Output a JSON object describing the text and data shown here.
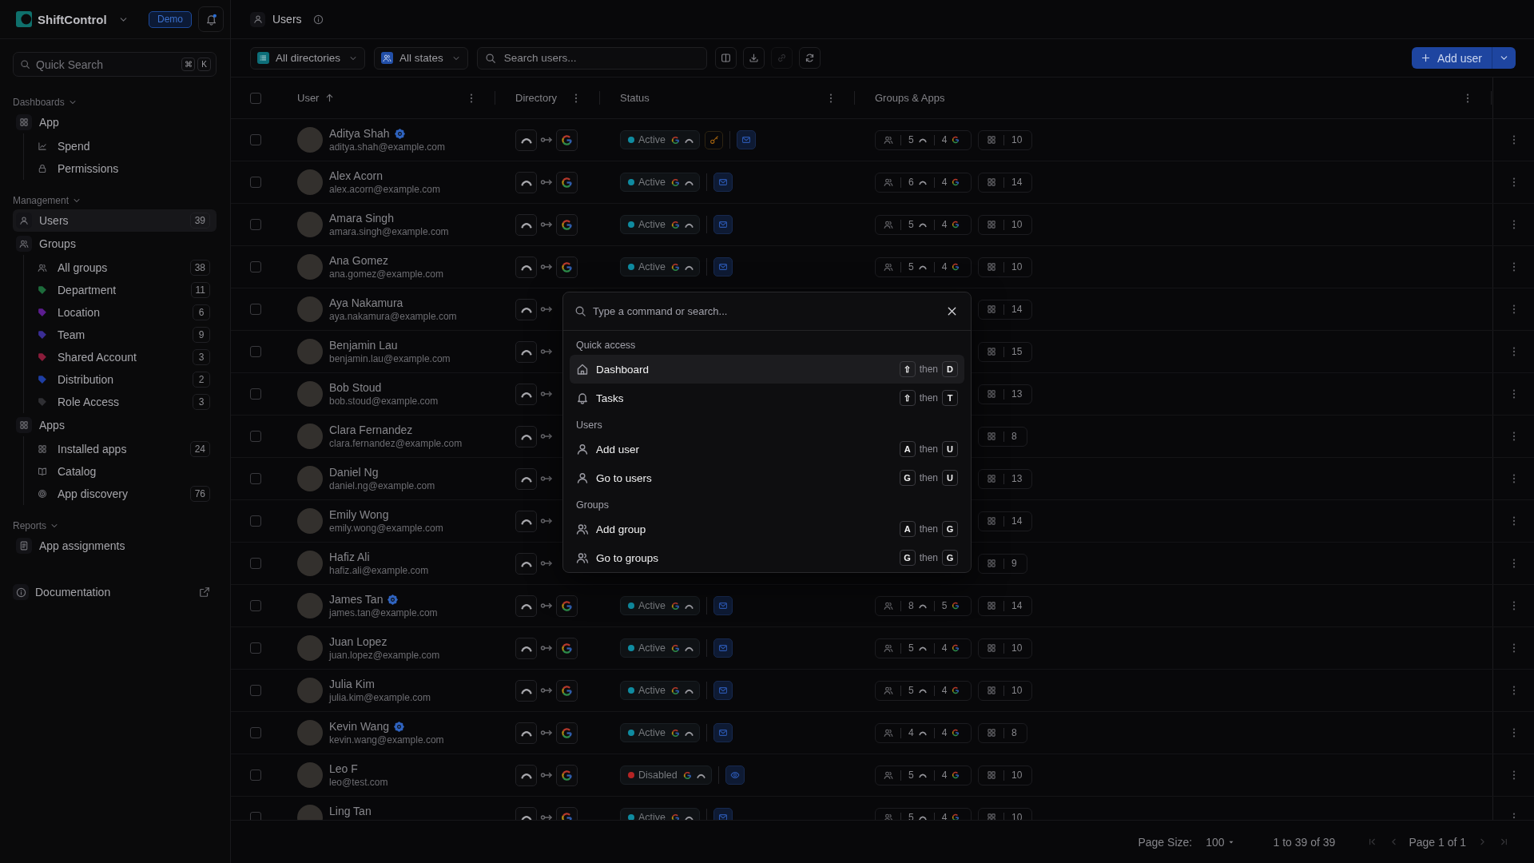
{
  "sidebar": {
    "brand": "ShiftControl",
    "badge": "Demo",
    "notifications": true,
    "search": {
      "placeholder": "Quick Search",
      "keys": [
        "⌘",
        "K"
      ]
    },
    "sections": [
      {
        "label": "Dashboards",
        "expanded": true,
        "items": [
          {
            "label": "App",
            "selected": false,
            "children": [
              {
                "label": "Spend",
                "kind": "page",
                "selected": false
              },
              {
                "label": "Permissions",
                "kind": "page",
                "selected": false
              }
            ]
          }
        ]
      },
      {
        "label": "Management",
        "expanded": true,
        "items": [
          {
            "label": "Users",
            "count": "39",
            "selected": true
          },
          {
            "label": "Groups",
            "selected": false,
            "children": [
              {
                "label": "All groups",
                "kind": "page",
                "count": "38",
                "selected": false
              },
              {
                "label": "Department",
                "kind": "tag",
                "color": "#1d6b3b",
                "count": "11",
                "selected": false
              },
              {
                "label": "Location",
                "kind": "tag",
                "color": "#5c1d8f",
                "count": "6",
                "selected": false
              },
              {
                "label": "Team",
                "kind": "tag",
                "color": "#3a2d94",
                "count": "9",
                "selected": false
              },
              {
                "label": "Shared Account",
                "kind": "tag",
                "color": "#8a1c3a",
                "count": "3",
                "selected": false
              },
              {
                "label": "Distribution",
                "kind": "tag",
                "color": "#1e3ea3",
                "count": "2",
                "selected": false
              },
              {
                "label": "Role Access",
                "kind": "tag",
                "color": "#2f2f33",
                "count": "3",
                "selected": false
              }
            ]
          },
          {
            "label": "Apps",
            "selected": false,
            "children": [
              {
                "label": "Installed apps",
                "kind": "page",
                "count": "24",
                "selected": false
              },
              {
                "label": "Catalog",
                "kind": "page",
                "selected": false
              },
              {
                "label": "App discovery",
                "kind": "page",
                "count": "76",
                "selected": false
              }
            ]
          }
        ]
      },
      {
        "label": "Reports",
        "expanded": true,
        "items": [
          {
            "label": "App assignments",
            "selected": false
          }
        ]
      }
    ],
    "documentation": {
      "label": "Documentation"
    }
  },
  "header": {
    "title": "Users"
  },
  "toolbar": {
    "filters": [
      {
        "label": "All directories",
        "kind": "directory"
      },
      {
        "label": "All states",
        "kind": "state"
      }
    ],
    "search": {
      "placeholder": "Search users..."
    },
    "actions": [
      {
        "disabled": false
      },
      {
        "disabled": false
      },
      {
        "disabled": true
      },
      {
        "disabled": false
      }
    ],
    "primary": {
      "label": "Add user"
    }
  },
  "table": {
    "select_all": {
      "checked": false
    },
    "columns": [
      {
        "label": "User",
        "sorted": true
      },
      {
        "label": "Directory",
        "sorted": false
      },
      {
        "label": "Status",
        "sorted": false
      },
      {
        "label": "Groups & Apps",
        "sorted": false
      }
    ],
    "rows": [
      {
        "name": "Aditya Shah",
        "email": "aditya.shah@example.com",
        "verified": true,
        "checked": false,
        "target": {
          "kind": "google"
        },
        "status": {
          "label": "Active",
          "kind": "active"
        },
        "key_flag": true,
        "action": {
          "kind": "mail"
        },
        "group_counts": [
          {
            "kind": "arc",
            "count": "5"
          },
          {
            "kind": "google",
            "count": "4"
          }
        ],
        "apps": "10"
      },
      {
        "name": "Alex Acorn",
        "email": "alex.acorn@example.com",
        "verified": false,
        "checked": false,
        "target": {
          "kind": "google"
        },
        "status": {
          "label": "Active",
          "kind": "active"
        },
        "key_flag": false,
        "action": {
          "kind": "mail"
        },
        "group_counts": [
          {
            "kind": "arc",
            "count": "6"
          },
          {
            "kind": "google",
            "count": "4"
          }
        ],
        "apps": "14"
      },
      {
        "name": "Amara Singh",
        "email": "amara.singh@example.com",
        "verified": false,
        "checked": false,
        "target": {
          "kind": "google"
        },
        "status": {
          "label": "Active",
          "kind": "active"
        },
        "key_flag": false,
        "action": {
          "kind": "mail"
        },
        "group_counts": [
          {
            "kind": "arc",
            "count": "5"
          },
          {
            "kind": "google",
            "count": "4"
          }
        ],
        "apps": "10"
      },
      {
        "name": "Ana Gomez",
        "email": "ana.gomez@example.com",
        "verified": false,
        "checked": false,
        "target": {
          "kind": "google"
        },
        "status": {
          "label": "Active",
          "kind": "active"
        },
        "key_flag": false,
        "action": {
          "kind": "mail"
        },
        "group_counts": [
          {
            "kind": "arc",
            "count": "5"
          },
          {
            "kind": "google",
            "count": "4"
          }
        ],
        "apps": "10"
      },
      {
        "name": "Aya Nakamura",
        "email": "aya.nakamura@example.com",
        "verified": false,
        "checked": false,
        "apps": "14"
      },
      {
        "name": "Benjamin Lau",
        "email": "benjamin.lau@example.com",
        "verified": false,
        "checked": false,
        "apps": "15"
      },
      {
        "name": "Bob Stoud",
        "email": "bob.stoud@example.com",
        "verified": false,
        "checked": false,
        "apps": "13"
      },
      {
        "name": "Clara Fernandez",
        "email": "clara.fernandez@example.com",
        "verified": false,
        "checked": false,
        "apps": "8"
      },
      {
        "name": "Daniel Ng",
        "email": "daniel.ng@example.com",
        "verified": false,
        "checked": false,
        "apps": "13"
      },
      {
        "name": "Emily Wong",
        "email": "emily.wong@example.com",
        "verified": false,
        "checked": false,
        "apps": "14"
      },
      {
        "name": "Hafiz Ali",
        "email": "hafiz.ali@example.com",
        "verified": false,
        "checked": false,
        "apps": "9"
      },
      {
        "name": "James Tan",
        "email": "james.tan@example.com",
        "verified": true,
        "checked": false,
        "target": {
          "kind": "google"
        },
        "status": {
          "label": "Active",
          "kind": "active"
        },
        "key_flag": false,
        "action": {
          "kind": "mail"
        },
        "group_counts": [
          {
            "kind": "arc",
            "count": "8"
          },
          {
            "kind": "google",
            "count": "5"
          }
        ],
        "apps": "14"
      },
      {
        "name": "Juan Lopez",
        "email": "juan.lopez@example.com",
        "verified": false,
        "checked": false,
        "target": {
          "kind": "google"
        },
        "status": {
          "label": "Active",
          "kind": "active"
        },
        "key_flag": false,
        "action": {
          "kind": "mail"
        },
        "group_counts": [
          {
            "kind": "arc",
            "count": "5"
          },
          {
            "kind": "google",
            "count": "4"
          }
        ],
        "apps": "10"
      },
      {
        "name": "Julia Kim",
        "email": "julia.kim@example.com",
        "verified": false,
        "checked": false,
        "target": {
          "kind": "google"
        },
        "status": {
          "label": "Active",
          "kind": "active"
        },
        "key_flag": false,
        "action": {
          "kind": "mail"
        },
        "group_counts": [
          {
            "kind": "arc",
            "count": "5"
          },
          {
            "kind": "google",
            "count": "4"
          }
        ],
        "apps": "10"
      },
      {
        "name": "Kevin Wang",
        "email": "kevin.wang@example.com",
        "verified": true,
        "checked": false,
        "target": {
          "kind": "google"
        },
        "status": {
          "label": "Active",
          "kind": "active"
        },
        "key_flag": false,
        "action": {
          "kind": "mail"
        },
        "group_counts": [
          {
            "kind": "arc",
            "count": "4"
          },
          {
            "kind": "google",
            "count": "4"
          }
        ],
        "apps": "8"
      },
      {
        "name": "Leo F",
        "email": "leo@test.com",
        "verified": false,
        "checked": false,
        "target": {
          "kind": "google"
        },
        "status": {
          "label": "Disabled",
          "kind": "disabled"
        },
        "key_flag": false,
        "action": {
          "kind": "eye"
        },
        "group_counts": [
          {
            "kind": "arc",
            "count": "5"
          },
          {
            "kind": "google",
            "count": "4"
          }
        ],
        "apps": "10"
      },
      {
        "name": "Ling Tan",
        "verified": false,
        "checked": false,
        "target": {
          "kind": "google"
        },
        "status": {
          "label": "Active",
          "kind": "active"
        },
        "key_flag": false,
        "action": {
          "kind": "mail"
        },
        "group_counts": [
          {
            "kind": "arc",
            "count": "5"
          },
          {
            "kind": "google",
            "count": "4"
          }
        ],
        "apps": "10"
      }
    ]
  },
  "pagination": {
    "page_size_label": "Page Size:",
    "page_size": "100",
    "range": "1 to 39 of 39",
    "page": "Page 1 of 1",
    "buttons": [
      {
        "disabled": true
      },
      {
        "disabled": true
      },
      {
        "disabled": true
      },
      {
        "disabled": true
      }
    ]
  },
  "command_palette": {
    "placeholder": "Type a command or search...",
    "sections": [
      {
        "label": "Quick access",
        "items": [
          {
            "label": "Dashboard",
            "selected": true,
            "keys": [
              "⇧",
              "D"
            ],
            "joiner": "then"
          },
          {
            "label": "Tasks",
            "selected": false,
            "keys": [
              "⇧",
              "T"
            ],
            "joiner": "then"
          }
        ]
      },
      {
        "label": "Users",
        "items": [
          {
            "label": "Add user",
            "selected": false,
            "keys": [
              "A",
              "U"
            ],
            "joiner": "then"
          },
          {
            "label": "Go to users",
            "selected": false,
            "keys": [
              "G",
              "U"
            ],
            "joiner": "then"
          }
        ]
      },
      {
        "label": "Groups",
        "items": [
          {
            "label": "Add group",
            "selected": false,
            "keys": [
              "A",
              "G"
            ],
            "joiner": "then"
          },
          {
            "label": "Go to groups",
            "selected": false,
            "keys": [
              "G",
              "G"
            ],
            "joiner": "then"
          }
        ]
      }
    ]
  }
}
